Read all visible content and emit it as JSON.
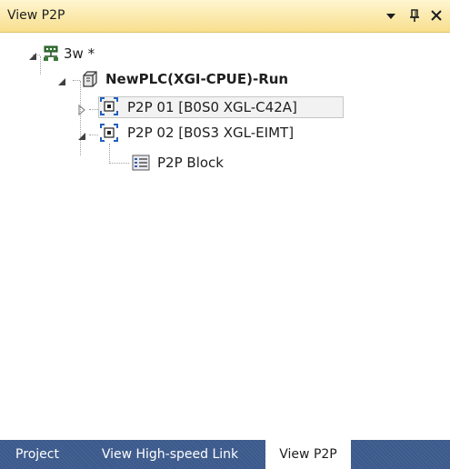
{
  "window": {
    "title": "View P2P"
  },
  "tree": {
    "root": {
      "label": "3w *"
    },
    "plc": {
      "label": "NewPLC(XGI-CPUE)-Run"
    },
    "p2p01": {
      "label": "P2P 01 [B0S0 XGL-C42A]",
      "selected": true
    },
    "p2p02": {
      "label": "P2P 02 [B0S3 XGL-EIMT]"
    },
    "block": {
      "label": "P2P Block"
    }
  },
  "tabs": [
    {
      "label": "Project",
      "active": false
    },
    {
      "label": "View High-speed Link",
      "active": false
    },
    {
      "label": "View P2P",
      "active": true
    }
  ],
  "colors": {
    "titlebar": "#f8df8e",
    "tab_strip": "#3c5a8c",
    "icon_blue": "#1f5fbf"
  }
}
